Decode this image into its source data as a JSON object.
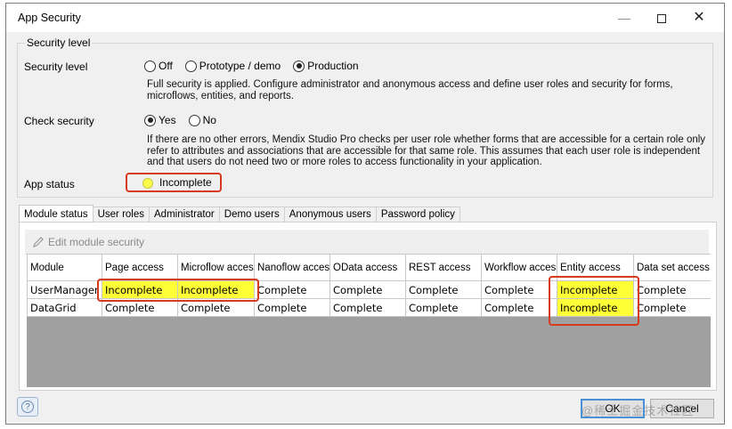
{
  "window": {
    "title": "App Security",
    "minimize": "—",
    "close": "✕"
  },
  "security": {
    "group_title": "Security level",
    "level_label": "Security level",
    "level_options": [
      "Off",
      "Prototype / demo",
      "Production"
    ],
    "level_selected": "Production",
    "level_description": "Full security is applied. Configure administrator and anonymous access and define user roles and security for forms, microflows, entities, and reports.",
    "check_label": "Check security",
    "check_options": [
      "Yes",
      "No"
    ],
    "check_selected": "Yes",
    "check_description": "If there are no other errors, Mendix Studio Pro checks per user role whether forms that are accessible for a certain role only refer to attributes and associations that are accessible for that same role. This assumes that each user role is independent and that users do not need two or more roles to access functionality in your application.",
    "app_status_label": "App status",
    "app_status_value": "Incomplete",
    "app_status_color": "#fbfb4c"
  },
  "tabs": [
    "Module status",
    "User roles",
    "Administrator",
    "Demo users",
    "Anonymous users",
    "Password policy"
  ],
  "active_tab": "Module status",
  "toolbar": {
    "edit_label": "Edit module security"
  },
  "table": {
    "headers": [
      "Module",
      "Page access",
      "Microflow access",
      "Nanoflow access",
      "OData access",
      "REST access",
      "Workflow access",
      "Entity access",
      "Data set access"
    ],
    "rows": [
      [
        "UserManager",
        "Incomplete",
        "Incomplete",
        "Complete",
        "Complete",
        "Complete",
        "Complete",
        "Incomplete",
        "Complete"
      ],
      [
        "DataGrid",
        "Complete",
        "Complete",
        "Complete",
        "Complete",
        "Complete",
        "Complete",
        "Incomplete",
        "Complete"
      ]
    ],
    "incomplete_color": "#ffff37"
  },
  "footer": {
    "help": "?",
    "ok": "OK",
    "cancel": "Cancel",
    "watermark": "@稀土掘金技术社区"
  },
  "highlight_color": "#d83a1e"
}
